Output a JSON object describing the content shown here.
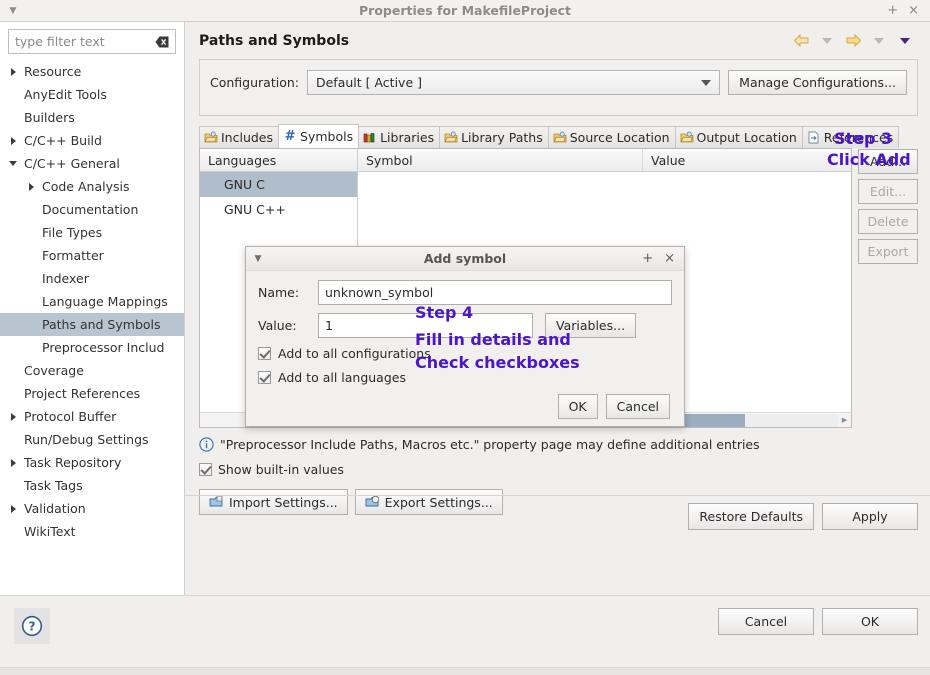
{
  "window": {
    "title": "Properties for MakefileProject",
    "menu_icon": "caret-down-icon",
    "maximize_label": "+",
    "close_label": "×"
  },
  "sidebar": {
    "filter": {
      "placeholder": "type filter text",
      "value": "",
      "clear_icon": "clear-field-icon"
    },
    "items": [
      {
        "label": "Resource",
        "indent": 0,
        "twisty": "right",
        "selected": false
      },
      {
        "label": "AnyEdit Tools",
        "indent": 0,
        "twisty": "none",
        "selected": false
      },
      {
        "label": "Builders",
        "indent": 0,
        "twisty": "none",
        "selected": false
      },
      {
        "label": "C/C++ Build",
        "indent": 0,
        "twisty": "right",
        "selected": false
      },
      {
        "label": "C/C++ General",
        "indent": 0,
        "twisty": "down",
        "selected": false
      },
      {
        "label": "Code Analysis",
        "indent": 1,
        "twisty": "right",
        "selected": false
      },
      {
        "label": "Documentation",
        "indent": 1,
        "twisty": "none",
        "selected": false
      },
      {
        "label": "File Types",
        "indent": 1,
        "twisty": "none",
        "selected": false
      },
      {
        "label": "Formatter",
        "indent": 1,
        "twisty": "none",
        "selected": false
      },
      {
        "label": "Indexer",
        "indent": 1,
        "twisty": "none",
        "selected": false
      },
      {
        "label": "Language Mappings",
        "indent": 1,
        "twisty": "none",
        "selected": false
      },
      {
        "label": "Paths and Symbols",
        "indent": 1,
        "twisty": "none",
        "selected": true
      },
      {
        "label": "Preprocessor Includ",
        "indent": 1,
        "twisty": "none",
        "selected": false
      },
      {
        "label": "Coverage",
        "indent": 0,
        "twisty": "none",
        "selected": false
      },
      {
        "label": "Project References",
        "indent": 0,
        "twisty": "none",
        "selected": false
      },
      {
        "label": "Protocol Buffer",
        "indent": 0,
        "twisty": "right",
        "selected": false
      },
      {
        "label": "Run/Debug Settings",
        "indent": 0,
        "twisty": "none",
        "selected": false
      },
      {
        "label": "Task Repository",
        "indent": 0,
        "twisty": "right",
        "selected": false
      },
      {
        "label": "Task Tags",
        "indent": 0,
        "twisty": "none",
        "selected": false
      },
      {
        "label": "Validation",
        "indent": 0,
        "twisty": "right",
        "selected": false
      },
      {
        "label": "WikiText",
        "indent": 0,
        "twisty": "none",
        "selected": false
      }
    ]
  },
  "header": {
    "title": "Paths and Symbols",
    "nav": [
      {
        "name": "back-arrow-icon",
        "kind": "left"
      },
      {
        "name": "back-dropdown-icon",
        "kind": "caret"
      },
      {
        "name": "forward-arrow-icon",
        "kind": "right"
      },
      {
        "name": "forward-dropdown-icon",
        "kind": "caret"
      },
      {
        "name": "view-menu-icon",
        "kind": "caret-dark"
      }
    ]
  },
  "configuration": {
    "label": "Configuration:",
    "value": "Default  [ Active ]",
    "manage_button": "Manage Configurations..."
  },
  "tabs": [
    {
      "label": "Includes",
      "icon": "includes-folder-icon",
      "active": false
    },
    {
      "label": "Symbols",
      "icon": "hash-icon",
      "active": true
    },
    {
      "label": "Libraries",
      "icon": "libraries-books-icon",
      "active": false
    },
    {
      "label": "Library Paths",
      "icon": "library-paths-folder-icon",
      "active": false
    },
    {
      "label": "Source Location",
      "icon": "source-location-folder-icon",
      "active": false
    },
    {
      "label": "Output Location",
      "icon": "output-location-folder-icon",
      "active": false
    },
    {
      "label": "References",
      "icon": "references-file-icon",
      "active": false
    }
  ],
  "table": {
    "columns": {
      "languages": "Languages",
      "symbol": "Symbol",
      "value": "Value"
    },
    "languages": [
      {
        "label": "GNU C",
        "selected": true
      },
      {
        "label": "GNU C++",
        "selected": false
      }
    ],
    "rows": []
  },
  "side_buttons": [
    {
      "label": "Add...",
      "enabled": true
    },
    {
      "label": "Edit...",
      "enabled": false
    },
    {
      "label": "Delete",
      "enabled": false
    },
    {
      "label": "Export",
      "enabled": false
    }
  ],
  "info": {
    "icon": "info-circle-icon",
    "text": "\"Preprocessor Include Paths, Macros etc.\" property page may define additional entries"
  },
  "show_builtin": {
    "label": "Show built-in values",
    "checked": true
  },
  "settings_buttons": [
    {
      "label": "Import Settings...",
      "icon": "import-settings-icon"
    },
    {
      "label": "Export Settings...",
      "icon": "export-settings-icon"
    }
  ],
  "apply_bar": {
    "restore_defaults": "Restore Defaults",
    "apply": "Apply"
  },
  "footer": {
    "help_icon": "help-question-icon",
    "cancel": "Cancel",
    "ok": "OK"
  },
  "dialog": {
    "title": "Add symbol",
    "menu_icon": "caret-down-icon",
    "maximize_label": "+",
    "close_label": "×",
    "name_label": "Name:",
    "name_value": "unknown_symbol",
    "value_label": "Value:",
    "value_value": "1",
    "variables_button": "Variables...",
    "check_all_configs": {
      "label": "Add to all configurations",
      "checked": true
    },
    "check_all_langs": {
      "label": "Add to all languages",
      "checked": true
    },
    "ok": "OK",
    "cancel": "Cancel"
  },
  "annotations": {
    "color": "#4b16c9",
    "step3_title": "Step 3",
    "step3_text": "Click Add",
    "step4_title": "Step 4",
    "step4_line1": "Fill in details and",
    "step4_line2": "Check checkboxes"
  }
}
